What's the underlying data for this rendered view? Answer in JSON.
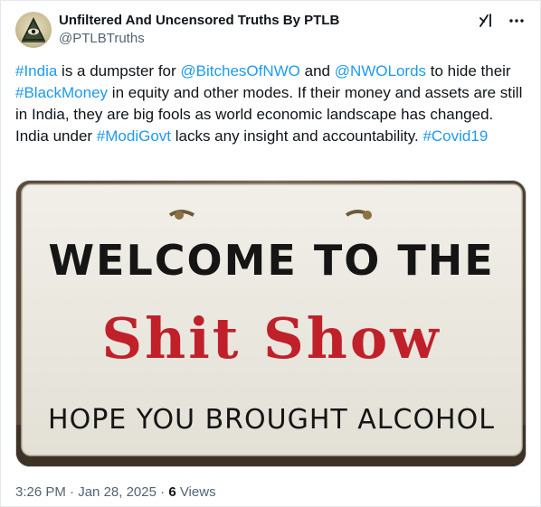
{
  "author": {
    "display_name": "Unfiltered And Uncensored Truths By PTLB",
    "handle": "@PTLBTruths"
  },
  "icons": {
    "avatar": "eye-pyramid-icon",
    "grok": "grok-icon",
    "more": "more-icon"
  },
  "tweet": {
    "segments": [
      {
        "text": "#India",
        "link": true
      },
      {
        "text": " is a dumpster for ",
        "link": false
      },
      {
        "text": "@BitchesOfNWO",
        "link": true
      },
      {
        "text": " and ",
        "link": false
      },
      {
        "text": "@NWOLords",
        "link": true
      },
      {
        "text": " to hide their ",
        "link": false
      },
      {
        "text": "#BlackMoney",
        "link": true
      },
      {
        "text": " in equity and other modes. If their money and assets are still in India, they are big fools as world economic landscape has changed. India under ",
        "link": false
      },
      {
        "text": "#ModiGovt",
        "link": true
      },
      {
        "text": " lacks any insight and accountability. ",
        "link": false
      },
      {
        "text": "#Covid19",
        "link": true
      }
    ]
  },
  "media": {
    "line1": "WELCOME TO THE",
    "line2": "Shit Show",
    "line3": "HOPE YOU BROUGHT ALCOHOL"
  },
  "meta": {
    "time": "3:26 PM",
    "date": "Jan 28, 2025",
    "separator": " · ",
    "views_count": "6",
    "views_label": "Views"
  },
  "colors": {
    "link": "#1d9bf0",
    "text": "#0f1419",
    "secondary": "#536471",
    "sign_red": "#c0202a"
  }
}
